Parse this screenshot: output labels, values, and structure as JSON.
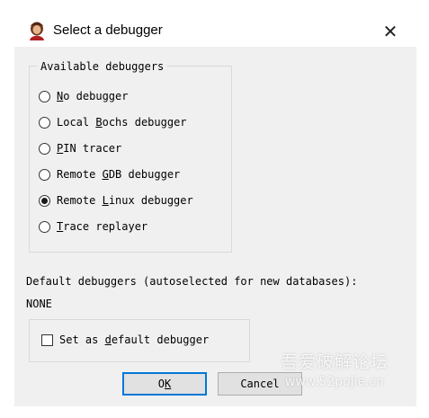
{
  "window": {
    "title": "Select a debugger",
    "close_glyph": "✕",
    "icon": "ida-app-icon"
  },
  "group": {
    "label": "Available debuggers",
    "options": [
      {
        "pre": "",
        "key": "N",
        "post": "o debugger",
        "selected": false
      },
      {
        "pre": "Local ",
        "key": "B",
        "post": "ochs debugger",
        "selected": false
      },
      {
        "pre": "",
        "key": "P",
        "post": "IN tracer",
        "selected": false
      },
      {
        "pre": "Remote ",
        "key": "G",
        "post": "DB debugger",
        "selected": false
      },
      {
        "pre": "Remote ",
        "key": "L",
        "post": "inux debugger",
        "selected": true
      },
      {
        "pre": "",
        "key": "T",
        "post": "race replayer",
        "selected": false
      }
    ]
  },
  "defaults": {
    "label": "Default debuggers (autoselected for new databases):",
    "value": "NONE"
  },
  "checkbox": {
    "pre": "Set as ",
    "key": "d",
    "post": "efault debugger",
    "checked": false
  },
  "buttons": {
    "ok_pre": "O",
    "ok_key": "K",
    "cancel": "Cancel"
  },
  "watermark": {
    "line1": "吾爱破解论坛",
    "line2": "www.52pojie.cn"
  }
}
